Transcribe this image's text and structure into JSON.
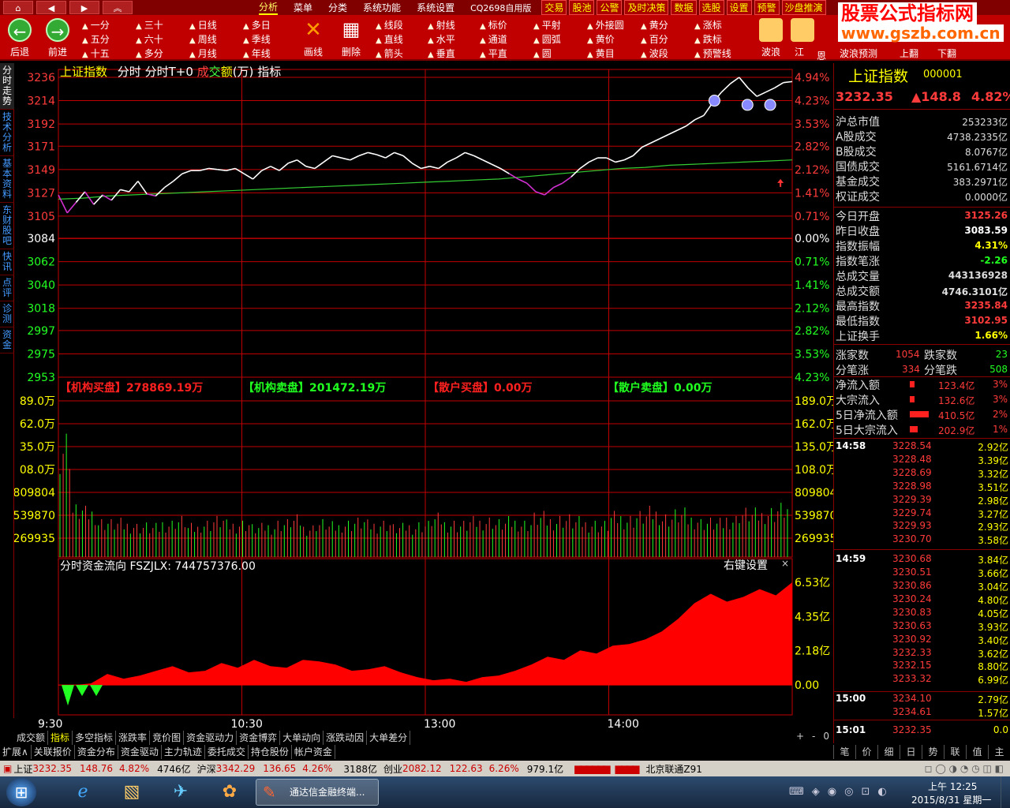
{
  "menubar": {
    "items": [
      "分析",
      "菜单",
      "分类",
      "系统功能",
      "系统设置",
      "CQ2698自用版"
    ],
    "right_items": [
      "交易",
      "股池",
      "公警",
      "及时决策",
      "数据",
      "选股",
      "设置",
      "预警",
      "沙盘推演"
    ]
  },
  "toolbar": {
    "back": "后退",
    "forward": "前进",
    "periods": [
      "一分",
      "三十",
      "日线",
      "多日",
      "五分",
      "六十",
      "周线",
      "季线",
      "十五",
      "多分",
      "月线",
      "年线"
    ],
    "draw": "画线",
    "delete": "删除",
    "tools": [
      "线段",
      "射线",
      "标价",
      "平射",
      "外接圆",
      "黄分",
      "涨标",
      "直线",
      "水平",
      "通道",
      "圆弧",
      "黄价",
      "百分",
      "跌标",
      "箭头",
      "垂直",
      "平直",
      "圆",
      "黄目",
      "波段",
      "预警线"
    ],
    "wave": "波浪",
    "jiang": "江",
    "en": "恩",
    "wave_predict": "波浪预测",
    "page_up": "上翻",
    "page_down": "下翻"
  },
  "watermark": {
    "title": "股票公式指标网",
    "url": "www.gszb.com.cn"
  },
  "left_nav": [
    "分时走势",
    "技术分析",
    "基本资料",
    "东财股吧",
    "快讯",
    "点评",
    "诊测",
    "资金"
  ],
  "chart_header": {
    "name": "上证指数",
    "parts": [
      "分时",
      "分时T+0"
    ],
    "cheng": "成",
    "jiao": "交",
    "e": "额",
    "wan": "(万)",
    "indicator": "指标"
  },
  "chart_data": [
    {
      "type": "line",
      "title": "上证指数 分时",
      "x_ticks": [
        "9:30",
        "10:30",
        "13:00",
        "14:00"
      ],
      "y_left_ticks": [
        3236,
        3214,
        3192,
        3171,
        3149,
        3127,
        3105,
        3084,
        3062,
        3040,
        3018,
        2997,
        2975,
        2953
      ],
      "y_right_ticks": [
        "4.94%",
        "4.23%",
        "3.53%",
        "2.82%",
        "2.12%",
        "1.41%",
        "0.71%",
        "0.00%",
        "0.71%",
        "1.41%",
        "2.12%",
        "2.82%",
        "3.53%",
        "4.23%"
      ],
      "ylim": [
        2953,
        3236
      ],
      "prev_close": 3084,
      "series": [
        {
          "name": "price",
          "values": [
            3125,
            3108,
            3118,
            3128,
            3116,
            3125,
            3120,
            3130,
            3128,
            3138,
            3126,
            3124,
            3132,
            3138,
            3145,
            3148,
            3148,
            3150,
            3149,
            3148,
            3150,
            3145,
            3140,
            3148,
            3152,
            3148,
            3155,
            3158,
            3152,
            3150,
            3156,
            3162,
            3160,
            3158,
            3162,
            3165,
            3163,
            3160,
            3165,
            3162,
            3155,
            3150,
            3152,
            3150,
            3156,
            3160,
            3165,
            3162,
            3158,
            3154,
            3150,
            3145,
            3140,
            3136,
            3128,
            3125,
            3132,
            3136,
            3142,
            3150,
            3156,
            3160,
            3160,
            3156,
            3158,
            3162,
            3170,
            3174,
            3178,
            3182,
            3186,
            3190,
            3196,
            3200,
            3212,
            3222,
            3230,
            3236,
            3226,
            3218,
            3222,
            3226,
            3231,
            3232
          ]
        },
        {
          "name": "average",
          "values": [
            3121,
            3122,
            3124,
            3125,
            3126,
            3127,
            3128,
            3129,
            3130,
            3131,
            3132,
            3133,
            3134,
            3135,
            3136,
            3137,
            3138,
            3139,
            3140,
            3142,
            3144,
            3146,
            3148,
            3150,
            3151,
            3153,
            3154,
            3155,
            3156,
            3157,
            3158
          ]
        }
      ]
    },
    {
      "type": "bar",
      "title": "成交额(万)",
      "y_left_ticks": [
        "89.0万",
        "62.0万",
        "35.0万",
        "08.0万",
        "809804",
        "539870",
        "269935"
      ],
      "y_right_ticks": [
        "189.0万",
        "162.0万",
        "135.0万",
        "108.0万",
        "809804",
        "539870",
        "269935"
      ],
      "legend": [
        {
          "label": "【机构买盘】278869.19万",
          "color": "#ff2020"
        },
        {
          "label": "【机构卖盘】201472.19万",
          "color": "#20ff20"
        },
        {
          "label": "【散户买盘】0.00万",
          "color": "#ff2020"
        },
        {
          "label": "【散户卖盘】0.00万",
          "color": "#20ff20"
        }
      ],
      "values": [
        780,
        320,
        300,
        240,
        230,
        220,
        210,
        200,
        230,
        250,
        200,
        230,
        250,
        220,
        230,
        200,
        210,
        230,
        250,
        200,
        230,
        210,
        230,
        240,
        220,
        230,
        200,
        210,
        220,
        260,
        230,
        220,
        240,
        250,
        230,
        240,
        230,
        270,
        250,
        260,
        240,
        230,
        220,
        270,
        260,
        280,
        300,
        270,
        290,
        260,
        240,
        230,
        260,
        300,
        290,
        310,
        330
      ]
    },
    {
      "type": "area",
      "title": "分时资金流向 FSZJLX: 744757376.00",
      "y_right_ticks": [
        "6.53亿",
        "4.35亿",
        "2.18亿",
        "0.00"
      ],
      "ylim": [
        -0.9,
        6.53
      ],
      "values": [
        -0.8,
        -0.2,
        0.1,
        0.7,
        0.4,
        0.6,
        0.9,
        1.2,
        0.8,
        0.9,
        1.4,
        1.1,
        1.6,
        1.2,
        1.1,
        1.6,
        1.5,
        1.3,
        0.9,
        1.0,
        1.2,
        0.8,
        0.5,
        0.3,
        0.4,
        0.2,
        0.5,
        0.6,
        0.9,
        1.3,
        1.8,
        1.6,
        2.2,
        2.0,
        2.5,
        2.6,
        2.9,
        3.4,
        4.2,
        5.2,
        5.8,
        5.3,
        5.6,
        6.1,
        5.7,
        6.53
      ]
    }
  ],
  "settings_label": "右键设置",
  "right_panel": {
    "name": "上证指数",
    "code": "000001",
    "price": "3232.35",
    "change": "▲148.8",
    "pct": "4.82%",
    "stats1": [
      {
        "k": "沪总市值",
        "v": "253233亿"
      },
      {
        "k": "A股成交",
        "v": "4738.2335亿"
      },
      {
        "k": "B股成交",
        "v": "8.0767亿"
      },
      {
        "k": "国债成交",
        "v": "5161.6714亿"
      },
      {
        "k": "基金成交",
        "v": "383.2971亿"
      },
      {
        "k": "权证成交",
        "v": "0.0000亿"
      }
    ],
    "stats2": [
      {
        "k": "今日开盘",
        "v": "3125.26",
        "c": "#ff3b3b"
      },
      {
        "k": "昨日收盘",
        "v": "3083.59",
        "c": "#ffffff"
      },
      {
        "k": "指数振幅",
        "v": "4.31%",
        "c": "#ffff00"
      },
      {
        "k": "指数笔涨",
        "v": "-2.26",
        "c": "#20ff20"
      },
      {
        "k": "总成交量",
        "v": "443136928",
        "c": "#dddddd"
      },
      {
        "k": "总成交额",
        "v": "4746.3101亿",
        "c": "#dddddd"
      },
      {
        "k": "最高指数",
        "v": "3235.84",
        "c": "#ff3b3b"
      },
      {
        "k": "最低指数",
        "v": "3102.95",
        "c": "#ff3b3b"
      },
      {
        "k": "上证换手",
        "v": "1.66%",
        "c": "#ffff00"
      }
    ],
    "rise_label": "涨家数",
    "rise": "1054",
    "fall_label": "跌家数",
    "fall": "23",
    "rise2_label": "分笔涨",
    "rise2": "334",
    "fall2_label": "分笔跌",
    "fall2": "508",
    "flows": [
      {
        "k": "净流入额",
        "v": "123.4亿",
        "p": "3%"
      },
      {
        "k": "大宗流入",
        "v": "132.6亿",
        "p": "3%"
      },
      {
        "k": "5日净流入额",
        "v": "410.5亿",
        "p": "2%"
      },
      {
        "k": "5日大宗流入",
        "v": "202.9亿",
        "p": "1%"
      }
    ],
    "ticks": [
      {
        "t": "14:58",
        "p": "3228.54",
        "v": "2.92亿"
      },
      {
        "t": "",
        "p": "3228.48",
        "v": "3.39亿"
      },
      {
        "t": "",
        "p": "3228.69",
        "v": "3.32亿"
      },
      {
        "t": "",
        "p": "3228.98",
        "v": "3.51亿"
      },
      {
        "t": "",
        "p": "3229.39",
        "v": "2.98亿"
      },
      {
        "t": "",
        "p": "3229.74",
        "v": "3.27亿"
      },
      {
        "t": "",
        "p": "3229.93",
        "v": "2.93亿"
      },
      {
        "t": "",
        "p": "3230.70",
        "v": "3.58亿"
      },
      {
        "t": "14:59",
        "p": "3230.68",
        "v": "3.84亿"
      },
      {
        "t": "",
        "p": "3230.51",
        "v": "3.66亿"
      },
      {
        "t": "",
        "p": "3230.86",
        "v": "3.04亿"
      },
      {
        "t": "",
        "p": "3230.24",
        "v": "4.80亿"
      },
      {
        "t": "",
        "p": "3230.83",
        "v": "4.05亿"
      },
      {
        "t": "",
        "p": "3230.63",
        "v": "3.93亿"
      },
      {
        "t": "",
        "p": "3230.92",
        "v": "3.40亿"
      },
      {
        "t": "",
        "p": "3232.33",
        "v": "3.62亿"
      },
      {
        "t": "",
        "p": "3232.15",
        "v": "8.80亿"
      },
      {
        "t": "",
        "p": "3233.32",
        "v": "6.99亿"
      },
      {
        "t": "15:00",
        "p": "3234.10",
        "v": "2.79亿"
      },
      {
        "t": "",
        "p": "3234.61",
        "v": "1.57亿"
      },
      {
        "t": "15:01",
        "p": "3232.35",
        "v": "0.0"
      }
    ]
  },
  "bottom_tabs": [
    "成交额",
    "指标",
    "多空指标",
    "涨跌率",
    "竞价图",
    "资金驱动力",
    "资金博弈",
    "大单动向",
    "涨跌动因",
    "大单差分"
  ],
  "bottom_tabs2": [
    "扩展∧",
    "关联报价",
    "资金分布",
    "资金驱动",
    "主力轨迹",
    "委托成交",
    "持仓股份",
    "帐户资金"
  ],
  "right_tabs": [
    "笔",
    "价",
    "细",
    "日",
    "势",
    "联",
    "值",
    "主"
  ],
  "status": {
    "sh_label": "上证",
    "sh": "3232.35",
    "sh_chg": "148.76",
    "sh_pct": "4.82%",
    "sh_amt": "4746亿",
    "hs_label": "沪深",
    "hs": "3342.29",
    "hs_chg": "136.65",
    "hs_pct": "4.26%",
    "hs_amt": "3188亿",
    "cy_label": "创业",
    "cy": "2082.12",
    "cy_chg": "122.63",
    "cy_pct": "6.26%",
    "cy_amt": "979.1亿",
    "server": "北京联通Z91"
  },
  "taskbar": {
    "app": "通达信金融终端...",
    "time": "上午 12:25",
    "date": "2015/8/31 星期一"
  }
}
